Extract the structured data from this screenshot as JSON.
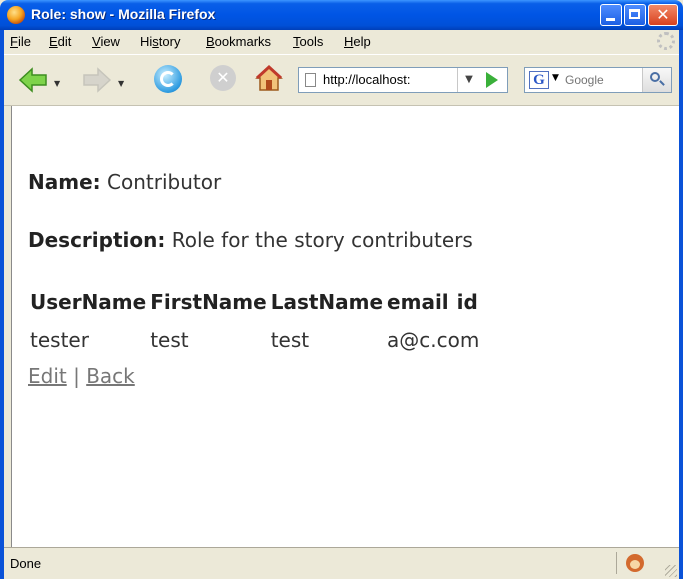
{
  "window": {
    "title": "Role: show - Mozilla Firefox"
  },
  "menu": {
    "items": [
      {
        "label": "File",
        "accel": "F"
      },
      {
        "label": "Edit",
        "accel": "E"
      },
      {
        "label": "View",
        "accel": "V"
      },
      {
        "label": "History",
        "accel": "s"
      },
      {
        "label": "Bookmarks",
        "accel": "B"
      },
      {
        "label": "Tools",
        "accel": "T"
      },
      {
        "label": "Help",
        "accel": "H"
      }
    ]
  },
  "navbar": {
    "url": "http://localhost:",
    "search_placeholder": "Google",
    "search_engine_letter": "G"
  },
  "page": {
    "name_label": "Name:",
    "name_value": "Contributor",
    "description_label": "Description:",
    "description_value": "Role for the story contributers",
    "table": {
      "headers": [
        "UserName",
        "FirstName",
        "LastName",
        "email",
        "id"
      ],
      "rows": [
        [
          "tester",
          "test",
          "test",
          "a@c.com",
          ""
        ]
      ]
    },
    "links": {
      "edit": "Edit",
      "separator": "|",
      "back": "Back"
    }
  },
  "status": {
    "text": "Done"
  },
  "colors": {
    "titlebar": "#0055e5",
    "chrome": "#ece9d8",
    "text": "#333333",
    "link": "#777777"
  }
}
